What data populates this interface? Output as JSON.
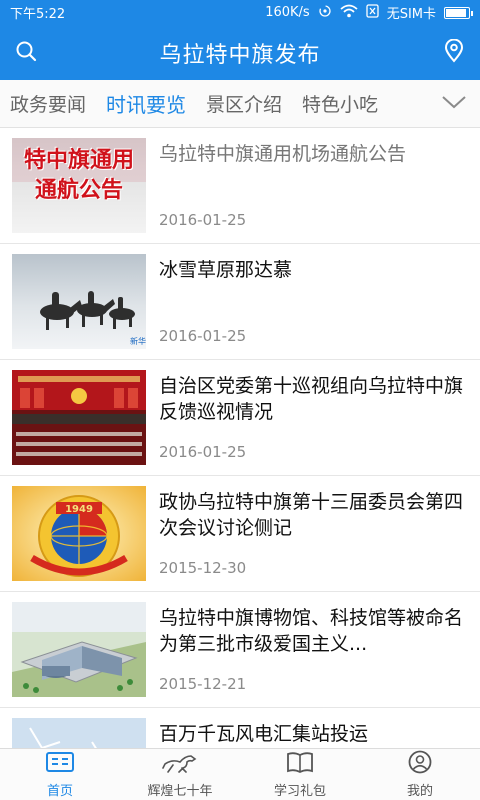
{
  "status": {
    "time": "下午5:22",
    "speed": "160K/s",
    "sim": "无SIM卡",
    "battery_level": 0.95
  },
  "header": {
    "title": "乌拉特中旗发布",
    "search_icon": "search-icon",
    "location_icon": "location-pin-icon"
  },
  "tabs": {
    "items": [
      "政务要闻",
      "时讯要览",
      "景区介绍",
      "特色小吃"
    ],
    "active_index": 1,
    "more_icon": "chevron-down-icon"
  },
  "colors": {
    "accent": "#1e88e5",
    "read_title": "#777777",
    "date": "#8a8a8a"
  },
  "news": [
    {
      "title": "乌拉特中旗通用机场通航公告",
      "date": "2016-01-25",
      "read": true,
      "thumb": {
        "type": "notice-banner",
        "lines": [
          "特中旗通用",
          "通航公告"
        ]
      }
    },
    {
      "title": "冰雪草原那达慕",
      "date": "2016-01-25",
      "read": false,
      "thumb": {
        "type": "horse-riders-snow",
        "caption": "新华"
      }
    },
    {
      "title": "自治区党委第十巡视组向乌拉特中旗反馈巡视情况",
      "date": "2016-01-25",
      "read": false,
      "thumb": {
        "type": "meeting-hall"
      }
    },
    {
      "title": "政协乌拉特中旗第十三届委员会第四次会议讨论侧记",
      "date": "2015-12-30",
      "read": false,
      "thumb": {
        "type": "cppcc-emblem",
        "caption": "1949"
      }
    },
    {
      "title": "乌拉特中旗博物馆、科技馆等被命名为第三批市级爱国主义...",
      "date": "2015-12-21",
      "read": false,
      "thumb": {
        "type": "museum-rendering"
      }
    },
    {
      "title": "百万千瓦风电汇集站投运",
      "date": "",
      "read": false,
      "thumb": {
        "type": "wind-turbines"
      }
    }
  ],
  "bottom_nav": [
    {
      "label": "首页",
      "icon": "news-home-icon",
      "active": true
    },
    {
      "label": "辉煌七十年",
      "icon": "horse-icon",
      "active": false
    },
    {
      "label": "学习礼包",
      "icon": "book-icon",
      "active": false
    },
    {
      "label": "我的",
      "icon": "user-icon",
      "active": false
    }
  ]
}
